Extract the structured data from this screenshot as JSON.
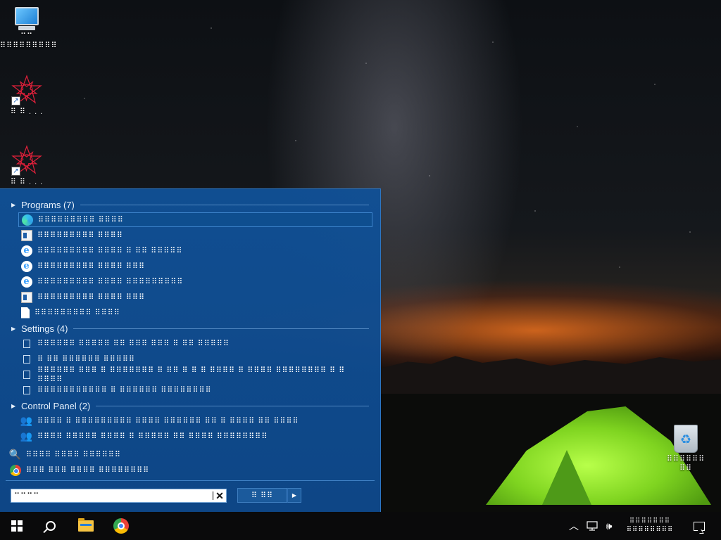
{
  "desktop": {
    "icons": [
      {
        "label": "⠉⠉\n⠿⠿⠿⠿⠿⠿⠿⠿⠿"
      },
      {
        "label": "⠿ ⠿ . . ."
      },
      {
        "label": "⠿ ⠿ . . ."
      },
      {
        "label": "⠿⠿⠿⠿⠿⠿\n⠿⠿"
      }
    ]
  },
  "search_panel": {
    "groups": {
      "programs": {
        "label": "Programs (7)"
      },
      "settings": {
        "label": "Settings (4)"
      },
      "control_panel": {
        "label": "Control Panel (2)"
      }
    },
    "programs": [
      {
        "text": "⠿⠿⠿⠿⠿⠿⠿⠿⠿ ⠿⠿⠿⠿",
        "icon": "edge-icon"
      },
      {
        "text": "⠿⠿⠿⠿⠿⠿⠿⠿⠿ ⠿⠿⠿⠿",
        "icon": "window-icon"
      },
      {
        "text": "⠿⠿⠿⠿⠿⠿⠿⠿⠿ ⠿⠿⠿⠿ ⠿ ⠿⠿ ⠿⠿⠿⠿⠿",
        "icon": "ie-icon"
      },
      {
        "text": "⠿⠿⠿⠿⠿⠿⠿⠿⠿ ⠿⠿⠿⠿ ⠿⠿⠿",
        "icon": "ie-icon"
      },
      {
        "text": "⠿⠿⠿⠿⠿⠿⠿⠿⠿ ⠿⠿⠿⠿ ⠿⠿⠿⠿⠿⠿⠿⠿⠿",
        "icon": "ie-icon"
      },
      {
        "text": "⠿⠿⠿⠿⠿⠿⠿⠿⠿ ⠿⠿⠿⠿ ⠿⠿⠿",
        "icon": "window-icon"
      },
      {
        "text": "⠿⠿⠿⠿⠿⠿⠿⠿⠿ ⠿⠿⠿⠿",
        "icon": "document-icon"
      }
    ],
    "settings": [
      {
        "text": "⠿⠿⠿⠿⠿⠿ ⠿⠿⠿⠿⠿ ⠿⠿ ⠿⠿⠿ ⠿⠿⠿ ⠿ ⠿⠿ ⠿⠿⠿⠿⠿"
      },
      {
        "text": "⠿ ⠿⠿ ⠿⠿⠿⠿⠿⠿ ⠿⠿⠿⠿⠿"
      },
      {
        "text": "⠿⠿⠿⠿⠿⠿ ⠿⠿⠿ ⠿ ⠿⠿⠿⠿⠿⠿⠿ ⠿ ⠿⠿ ⠿ ⠿ ⠿ ⠿⠿⠿⠿ ⠿ ⠿⠿⠿⠿ ⠿⠿⠿⠿⠿⠿⠿⠿ ⠿ ⠿ ⠿⠿⠿⠿"
      },
      {
        "text": "⠿⠿⠿⠿⠿⠿⠿⠿⠿⠿⠿ ⠿ ⠿⠿⠿⠿⠿⠿ ⠿⠿⠿⠿⠿⠿⠿⠿"
      }
    ],
    "control_panel": [
      {
        "text": "⠿⠿⠿⠿ ⠿ ⠿⠿⠿⠿⠿⠿⠿⠿⠿ ⠿⠿⠿⠿ ⠿⠿⠿⠿⠿⠿ ⠿⠿ ⠿ ⠿⠿⠿⠿ ⠿⠿ ⠿⠿⠿⠿"
      },
      {
        "text": "⠿⠿⠿⠿ ⠿⠿⠿⠿⠿ ⠿⠿⠿⠿ ⠿ ⠿⠿⠿⠿⠿ ⠿⠿ ⠿⠿⠿⠿ ⠿⠿⠿⠿⠿⠿⠿⠿"
      }
    ],
    "extra": [
      {
        "text": "⠿⠿⠿⠿ ⠿⠿⠿⠿ ⠿⠿⠿⠿⠿⠿",
        "icon": "magnifier-icon"
      },
      {
        "text": "⠿⠿⠿ ⠿⠿⠿ ⠿⠿⠿⠿ ⠿⠿⠿⠿⠿⠿⠿⠿",
        "icon": "chrome-icon"
      }
    ],
    "search_box": {
      "value": "⠉⠉⠉⠉"
    },
    "shutdown_button": {
      "label": "⠿ ⠿⠿"
    }
  },
  "taskbar": {
    "clock": {
      "time": "⠿⠿⠿⠿⠿⠿⠿",
      "date": "⠿⠿⠿⠿⠿⠿⠿⠿"
    }
  },
  "colors": {
    "panel": "#0f4f92",
    "selected": "#0e4e8f",
    "taskbar": "#0a0a0b"
  }
}
